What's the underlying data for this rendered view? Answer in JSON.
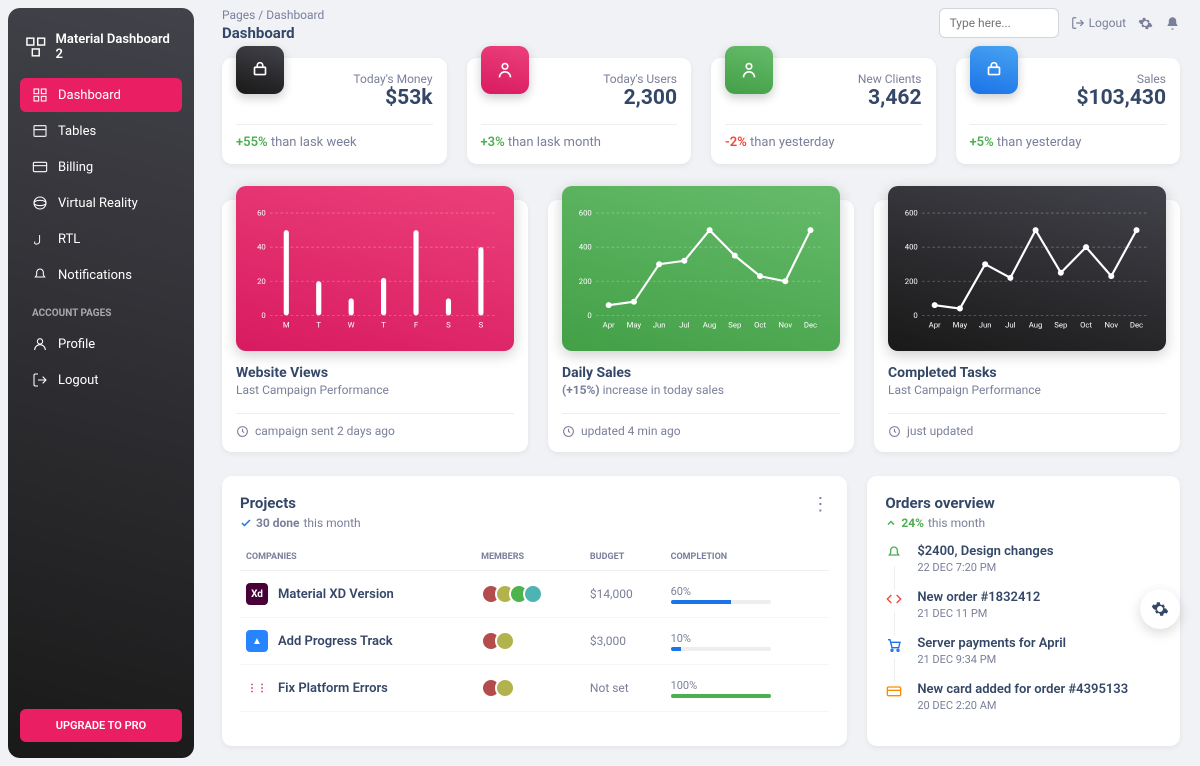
{
  "brand": "Material Dashboard 2",
  "breadcrumb": {
    "parent": "Pages",
    "current": "Dashboard"
  },
  "page_title": "Dashboard",
  "search": {
    "placeholder": "Type here..."
  },
  "logout": "Logout",
  "sidebar": {
    "items": [
      {
        "label": "Dashboard",
        "active": true
      },
      {
        "label": "Tables"
      },
      {
        "label": "Billing"
      },
      {
        "label": "Virtual Reality"
      },
      {
        "label": "RTL"
      },
      {
        "label": "Notifications"
      }
    ],
    "section": "Account Pages",
    "account": [
      {
        "label": "Profile"
      },
      {
        "label": "Logout"
      }
    ],
    "upgrade": "Upgrade to Pro"
  },
  "stats": [
    {
      "label": "Today's Money",
      "value": "$53k",
      "delta": "+55%",
      "delta_sign": "pos",
      "foot": " than lask week",
      "icon": "dark"
    },
    {
      "label": "Today's Users",
      "value": "2,300",
      "delta": "+3%",
      "delta_sign": "pos",
      "foot": " than lask month",
      "icon": "pink"
    },
    {
      "label": "New Clients",
      "value": "3,462",
      "delta": "-2%",
      "delta_sign": "neg",
      "foot": " than yesterday",
      "icon": "green"
    },
    {
      "label": "Sales",
      "value": "$103,430",
      "delta": "+5%",
      "delta_sign": "pos",
      "foot": " than yesterday",
      "icon": "blue"
    }
  ],
  "charts": [
    {
      "title": "Website Views",
      "sub": "Last Campaign Performance",
      "foot": "campaign sent 2 days ago",
      "color": "pink"
    },
    {
      "title": "Daily Sales",
      "sub_prefix": "(+15%)",
      "sub": " increase in today sales",
      "foot": "updated 4 min ago",
      "color": "green"
    },
    {
      "title": "Completed Tasks",
      "sub": "Last Campaign Performance",
      "foot": "just updated",
      "color": "dark"
    }
  ],
  "chart_data": [
    {
      "type": "bar",
      "categories": [
        "M",
        "T",
        "W",
        "T",
        "F",
        "S",
        "S"
      ],
      "values": [
        50,
        20,
        10,
        22,
        50,
        10,
        40
      ],
      "ylim": [
        0,
        60
      ],
      "yticks": [
        0,
        20,
        40,
        60
      ]
    },
    {
      "type": "line",
      "x": [
        "Apr",
        "May",
        "Jun",
        "Jul",
        "Aug",
        "Sep",
        "Oct",
        "Nov",
        "Dec"
      ],
      "values": [
        60,
        80,
        300,
        320,
        500,
        350,
        230,
        200,
        500
      ],
      "ylim": [
        0,
        600
      ],
      "yticks": [
        0,
        200,
        400,
        600
      ]
    },
    {
      "type": "line",
      "x": [
        "Apr",
        "May",
        "Jun",
        "Jul",
        "Aug",
        "Sep",
        "Oct",
        "Nov",
        "Dec"
      ],
      "values": [
        60,
        40,
        300,
        220,
        500,
        250,
        400,
        230,
        500
      ],
      "ylim": [
        0,
        600
      ],
      "yticks": [
        0,
        200,
        400,
        600
      ]
    }
  ],
  "projects": {
    "title": "Projects",
    "sub_bold": "30 done",
    "sub_rest": " this month",
    "headers": [
      "Companies",
      "Members",
      "Budget",
      "Completion"
    ],
    "rows": [
      {
        "company": "Material XD Version",
        "logo_bg": "#470137",
        "logo_txt": "Xd",
        "members": 4,
        "budget": "$14,000",
        "completion": "60%",
        "pct": 60,
        "done": false
      },
      {
        "company": "Add Progress Track",
        "logo_bg": "#2684ff",
        "logo_txt": "▲",
        "members": 2,
        "budget": "$3,000",
        "completion": "10%",
        "pct": 10,
        "done": false
      },
      {
        "company": "Fix Platform Errors",
        "logo_bg": "#fff",
        "logo_txt": "⋮⋮",
        "members": 2,
        "budget": "Not set",
        "completion": "100%",
        "pct": 100,
        "done": true
      }
    ]
  },
  "orders": {
    "title": "Orders overview",
    "sub_bold": "24%",
    "sub_rest": " this month",
    "items": [
      {
        "title": "$2400, Design changes",
        "time": "22 DEC 7:20 PM",
        "color": "#4caf50",
        "icon": "bell"
      },
      {
        "title": "New order #1832412",
        "time": "21 DEC 11 PM",
        "color": "#f44336",
        "icon": "code"
      },
      {
        "title": "Server payments for April",
        "time": "21 DEC 9:34 PM",
        "color": "#1a73e8",
        "icon": "cart"
      },
      {
        "title": "New card added for order #4395133",
        "time": "20 DEC 2:20 AM",
        "color": "#fb8c00",
        "icon": "card"
      }
    ]
  }
}
